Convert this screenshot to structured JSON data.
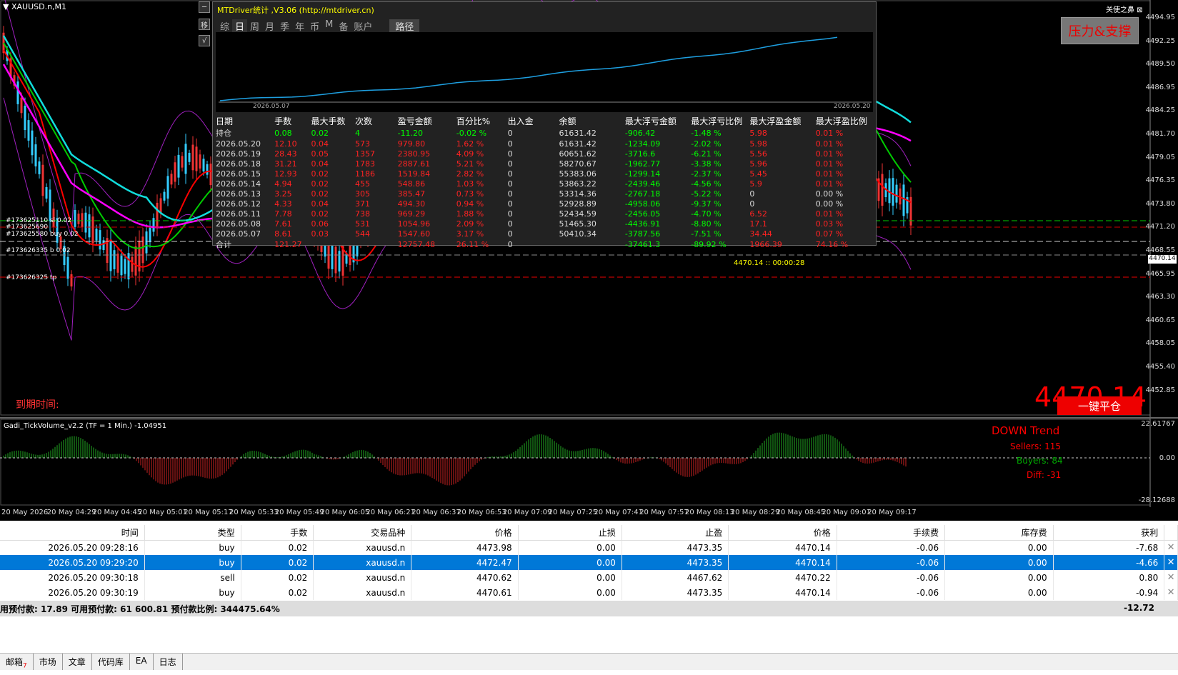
{
  "window": {
    "symbol": "XAUUSD.n,M1",
    "top_right": "关使之鼻 ⊠",
    "sr_box": "压力&支撑"
  },
  "side_buttons": [
    "─",
    "移",
    "√"
  ],
  "y_axis": [
    "4494.95",
    "4492.25",
    "4489.50",
    "4486.95",
    "4484.25",
    "4481.70",
    "4479.05",
    "4476.35",
    "4473.80",
    "4471.20",
    "4468.55",
    "4465.95",
    "4463.30",
    "4460.65",
    "4458.05",
    "4455.40",
    "4452.85"
  ],
  "x_axis": [
    "20 May 2026",
    "20 May 04:29",
    "20 May 04:45",
    "20 May 05:01",
    "20 May 05:17",
    "20 May 05:33",
    "20 May 05:49",
    "20 May 06:05",
    "20 May 06:21",
    "20 May 06:37",
    "20 May 06:53",
    "20 May 07:09",
    "20 May 07:25",
    "20 May 07:41",
    "20 May 07:57",
    "20 May 08:13",
    "20 May 08:29",
    "20 May 08:45",
    "20 May 09:01",
    "20 May 09:17"
  ],
  "current_price": "4470.14",
  "tickets": [
    "#173625110 sl 0.02",
    "#173625690",
    "#173625580 buy 0.02",
    "#173626335 b 0.02",
    "#173626325 tp"
  ],
  "stats": {
    "title": "MTDriver统计 ,V3.06 (http://mtdriver.cn)",
    "tabs": [
      "综",
      "日",
      "周",
      "月",
      "季",
      "年",
      "币",
      "M",
      "备",
      "账户"
    ],
    "active_tab": "日",
    "path_tab": "路径",
    "graph_start": "2026.05.07",
    "graph_end": "2026.05.20",
    "headers": [
      "日期",
      "手数",
      "最大手数",
      "次数",
      "盈亏金额",
      "百分比%",
      "出入金",
      "余额",
      "最大浮亏金额",
      "最大浮亏比例",
      "最大浮盈金额",
      "最大浮盈比例"
    ],
    "rows": [
      [
        "持仓",
        "0.08",
        "0.02",
        "4",
        "-11.20",
        "-0.02 %",
        "0",
        "61631.42",
        "-906.42",
        "-1.48 %",
        "5.98",
        "0.01 %"
      ],
      [
        "2026.05.20",
        "12.10",
        "0.04",
        "573",
        "979.80",
        "1.62 %",
        "0",
        "61631.42",
        "-1234.09",
        "-2.02 %",
        "5.98",
        "0.01 %"
      ],
      [
        "2026.05.19",
        "28.43",
        "0.05",
        "1357",
        "2380.95",
        "4.09 %",
        "0",
        "60651.62",
        "-3716.6",
        "-6.21 %",
        "5.56",
        "0.01 %"
      ],
      [
        "2026.05.18",
        "31.21",
        "0.04",
        "1783",
        "2887.61",
        "5.21 %",
        "0",
        "58270.67",
        "-1962.77",
        "-3.38 %",
        "5.96",
        "0.01 %"
      ],
      [
        "2026.05.15",
        "12.93",
        "0.02",
        "1186",
        "1519.84",
        "2.82 %",
        "0",
        "55383.06",
        "-1299.14",
        "-2.37 %",
        "5.45",
        "0.01 %"
      ],
      [
        "2026.05.14",
        "4.94",
        "0.02",
        "455",
        "548.86",
        "1.03 %",
        "0",
        "53863.22",
        "-2439.46",
        "-4.56 %",
        "5.9",
        "0.01 %"
      ],
      [
        "2026.05.13",
        "3.25",
        "0.02",
        "305",
        "385.47",
        "0.73 %",
        "0",
        "53314.36",
        "-2767.18",
        "-5.22 %",
        "0",
        "0.00 %"
      ],
      [
        "2026.05.12",
        "4.33",
        "0.04",
        "371",
        "494.30",
        "0.94 %",
        "0",
        "52928.89",
        "-4958.06",
        "-9.37 %",
        "0",
        "0.00 %"
      ],
      [
        "2026.05.11",
        "7.78",
        "0.02",
        "738",
        "969.29",
        "1.88 %",
        "0",
        "52434.59",
        "-2456.05",
        "-4.70 %",
        "6.52",
        "0.01 %"
      ],
      [
        "2026.05.08",
        "7.61",
        "0.06",
        "531",
        "1054.96",
        "2.09 %",
        "0",
        "51465.30",
        "-4436.91",
        "-8.80 %",
        "17.1",
        "0.03 %"
      ],
      [
        "2026.05.07",
        "8.61",
        "0.03",
        "544",
        "1547.60",
        "3.17 %",
        "0",
        "50410.34",
        "-3787.56",
        "-7.51 %",
        "34.44",
        "0.07 %"
      ],
      [
        "合计",
        "121.27",
        "",
        "",
        "12757.48",
        "26.11 %",
        "0",
        "",
        "-37461.3",
        "-89.92 %",
        "1966.39",
        "74.16 %"
      ]
    ]
  },
  "expiry_label": "到期时间:",
  "big_price": "4470.14",
  "close_all_button": "一键平仓",
  "inline_price_label": "4470.14 :: 00:00:28",
  "indicator": {
    "label": "Gadi_TickVolume_v2.2 (TF = 1 Min.) -1.04951",
    "trend": "DOWN Trend",
    "sellers": "Sellers: 115",
    "buyers": "Buyers: 84",
    "diff": "Diff: -31",
    "y_top": "22.61767",
    "y_mid": "0.00",
    "y_bot": "-28.12688"
  },
  "terminal": {
    "headers": [
      "时间",
      "类型",
      "手数",
      "交易品种",
      "价格",
      "止损",
      "止盈",
      "价格",
      "手续费",
      "库存费",
      "获利"
    ],
    "rows": [
      [
        "2026.05.20 09:28:16",
        "buy",
        "0.02",
        "xauusd.n",
        "4473.98",
        "0.00",
        "4473.35",
        "4470.14",
        "-0.06",
        "0.00",
        "-7.68"
      ],
      [
        "2026.05.20 09:29:20",
        "buy",
        "0.02",
        "xauusd.n",
        "4472.47",
        "0.00",
        "4473.35",
        "4470.14",
        "-0.06",
        "0.00",
        "-4.66"
      ],
      [
        "2026.05.20 09:30:18",
        "sell",
        "0.02",
        "xauusd.n",
        "4470.62",
        "0.00",
        "4467.62",
        "4470.22",
        "-0.06",
        "0.00",
        "0.80"
      ],
      [
        "2026.05.20 09:30:19",
        "buy",
        "0.02",
        "xauusd.n",
        "4470.61",
        "0.00",
        "4473.35",
        "4470.14",
        "-0.06",
        "0.00",
        "-0.94"
      ]
    ],
    "selected_row": 1,
    "summary": "用预付款: 17.89  可用预付款: 61 600.81  预付款比例: 344475.64%",
    "total": "-12.72",
    "bottom_tabs": [
      "邮箱",
      "市场",
      "文章",
      "代码库",
      "EA",
      "日志"
    ],
    "mail_badge": "7"
  }
}
